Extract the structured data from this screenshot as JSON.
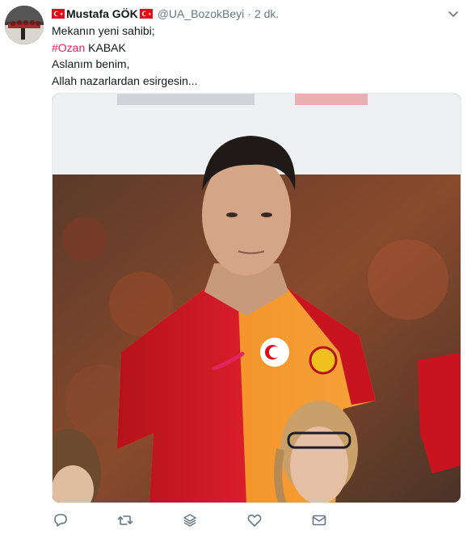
{
  "tweet": {
    "author": {
      "display_name": "Mustafa GÖK",
      "handle": "@UA_BozokBeyi",
      "flag_icon": "turkey-flag-icon"
    },
    "separator": "·",
    "timestamp": "2 dk.",
    "text": {
      "line1": "Mekanın yeni sahibi;",
      "line2_hashtag": "#Ozan",
      "line2_rest": " KABAK",
      "line3": "Aslanım benim,",
      "line4": "Allah nazarlardan esirgesin..."
    },
    "actions": {
      "reply_icon": "reply-icon",
      "retweet_icon": "retweet-icon",
      "stack_icon": "stack-icon",
      "like_icon": "heart-icon",
      "dm_icon": "envelope-icon"
    }
  },
  "colors": {
    "hashtag": "#e0245e",
    "secondary_text": "#657786",
    "primary_text": "#14171a",
    "flag_red": "#e30a17"
  }
}
